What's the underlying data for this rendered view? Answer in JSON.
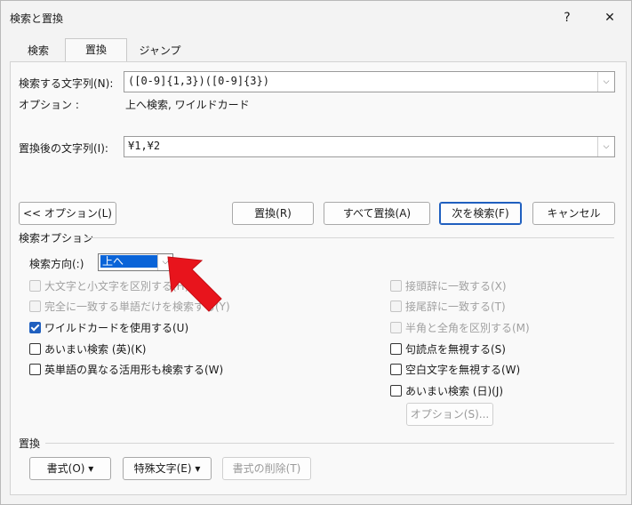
{
  "window": {
    "title": "検索と置換",
    "help_label": "?",
    "close_label": "✕"
  },
  "tabs": [
    {
      "label": "検索"
    },
    {
      "label": "置換"
    },
    {
      "label": "ジャンプ"
    }
  ],
  "find": {
    "label": "検索する文字列(N):",
    "value": "([0-9]{1,3})([0-9]{3})"
  },
  "options_line": {
    "label": "オプション :",
    "value": "上へ検索, ワイルドカード"
  },
  "replace": {
    "label": "置換後の文字列(I):",
    "value": "¥1,¥2"
  },
  "buttons": {
    "options": "<< オプション(L)",
    "replace": "置換(R)",
    "replace_all": "すべて置換(A)",
    "find_next": "次を検索(F)",
    "cancel": "キャンセル"
  },
  "search_options": {
    "title": "検索オプション",
    "direction_label": "検索方向(:)",
    "direction_value": "上へ",
    "left": [
      {
        "label": "大文字と小文字を区別する(H)",
        "checked": false,
        "enabled": false
      },
      {
        "label": "完全に一致する単語だけを検索する(Y)",
        "checked": false,
        "enabled": false
      },
      {
        "label": "ワイルドカードを使用する(U)",
        "checked": true,
        "enabled": true
      },
      {
        "label": "あいまい検索 (英)(K)",
        "checked": false,
        "enabled": true
      },
      {
        "label": "英単語の異なる活用形も検索する(W)",
        "checked": false,
        "enabled": true
      }
    ],
    "right": [
      {
        "label": "接頭辞に一致する(X)",
        "checked": false,
        "enabled": false
      },
      {
        "label": "接尾辞に一致する(T)",
        "checked": false,
        "enabled": false
      },
      {
        "label": "半角と全角を区別する(M)",
        "checked": false,
        "enabled": false
      },
      {
        "label": "句読点を無視する(S)",
        "checked": false,
        "enabled": true
      },
      {
        "label": "空白文字を無視する(W)",
        "checked": false,
        "enabled": true
      },
      {
        "label": "あいまい検索 (日)(J)",
        "checked": false,
        "enabled": true
      }
    ],
    "fuzzy_options_button": "オプション(S)..."
  },
  "replace_section": {
    "title": "置換",
    "format_button": "書式(O) ▾",
    "special_button": "特殊文字(E) ▾",
    "no_format_button": "書式の削除(T)"
  },
  "colors": {
    "accent": "#1f5fbf",
    "highlight": "#0a64d8",
    "annotation_arrow": "#e8141c"
  },
  "icons": {
    "dropdown": "chevron-down-icon",
    "close": "close-icon",
    "help": "help-icon",
    "annotation": "red-arrow-icon"
  }
}
